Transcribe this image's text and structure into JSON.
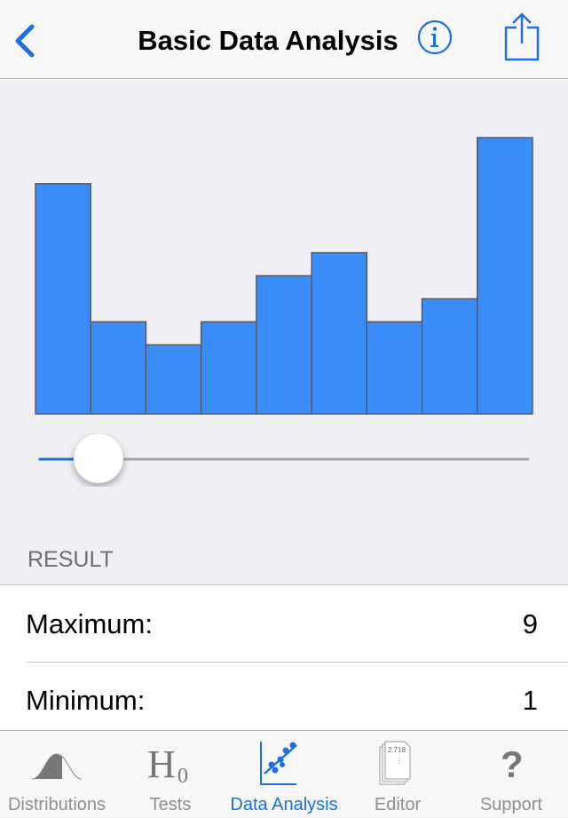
{
  "header": {
    "title": "Basic Data Analysis",
    "back_icon": "chevron-left-icon",
    "info_icon": "info-icon",
    "share_icon": "share-icon"
  },
  "colors": {
    "accent": "#1a6ee6",
    "bar_fill": "#3a8cf6",
    "bar_stroke": "#555b66",
    "track": "#a8a8a8"
  },
  "chart_data": {
    "type": "bar",
    "relative_heights": [
      10,
      4,
      3,
      4,
      6,
      7,
      4,
      5,
      12
    ],
    "grid": false,
    "axes_shown": false
  },
  "slider": {
    "value_fraction": 0.12
  },
  "result": {
    "section_label": "RESULT",
    "rows": [
      {
        "label": "Maximum:",
        "value": "9"
      },
      {
        "label": "Minimum:",
        "value": "1"
      }
    ]
  },
  "tabs": [
    {
      "label": "Distributions",
      "icon": "bell-curve-icon",
      "active": false
    },
    {
      "label": "Tests",
      "icon": "hypothesis-icon",
      "active": false,
      "glyph": "H",
      "sub": "0"
    },
    {
      "label": "Data Analysis",
      "icon": "scatter-plot-icon",
      "active": true
    },
    {
      "label": "Editor",
      "icon": "document-stack-icon",
      "active": false,
      "doc_text": "2.718"
    },
    {
      "label": "Support",
      "icon": "question-mark-icon",
      "active": false,
      "glyph": "?"
    }
  ]
}
